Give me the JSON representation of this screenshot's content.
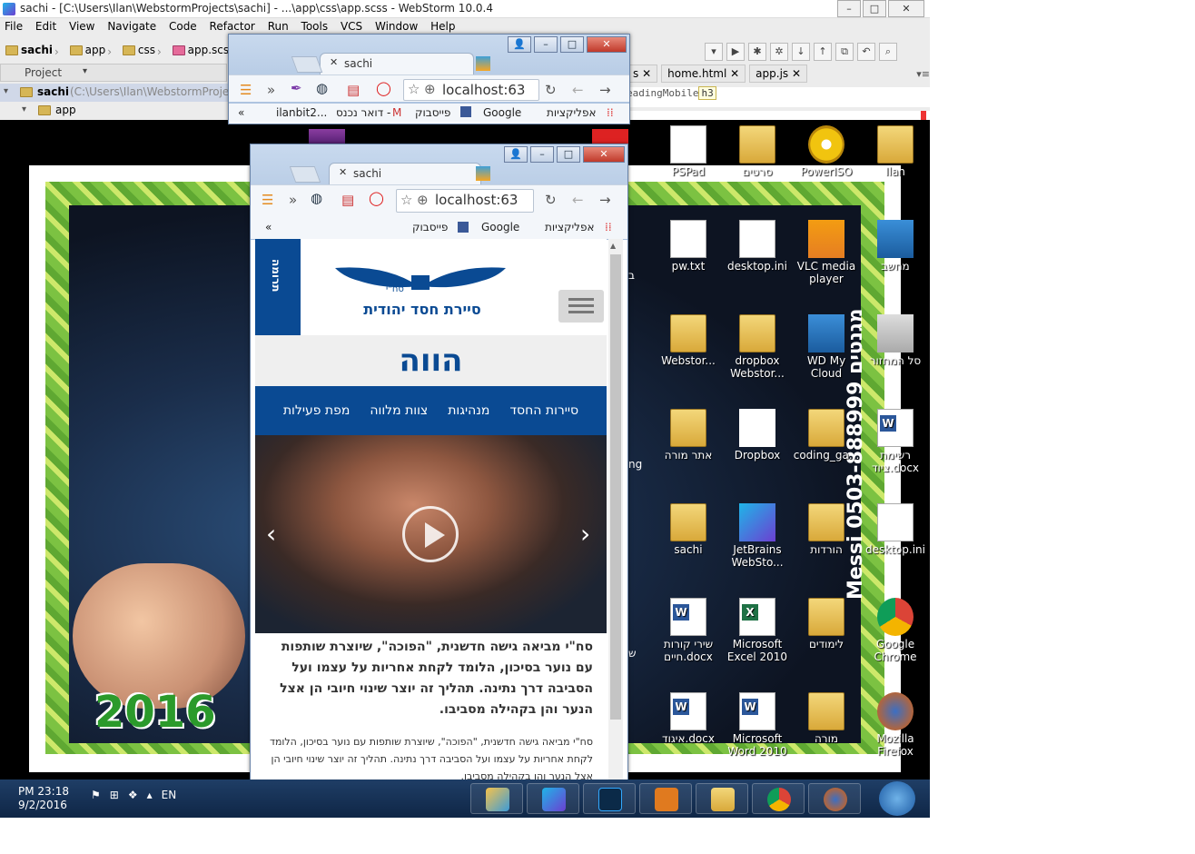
{
  "webstorm": {
    "title": "sachi - [C:\\Users\\Ilan\\WebstormProjects\\sachi] - ...\\app\\css\\app.scss - WebStorm 10.0.4",
    "menu": [
      "File",
      "Edit",
      "View",
      "Navigate",
      "Code",
      "Refactor",
      "Run",
      "Tools",
      "VCS",
      "Window",
      "Help"
    ],
    "breadcrumb": [
      "sachi",
      "app",
      "css",
      "app.scss"
    ],
    "project_label": "Project",
    "tree_root": "sachi",
    "tree_root_path": "(C:\\Users\\Ilan\\WebstormProject",
    "tree_child": "app",
    "tabs": [
      "home.html",
      "app.js"
    ],
    "editor_text": "eadingMobile",
    "editor_tag": "h3"
  },
  "desktop": {
    "photo_year": "2016",
    "vertical_text": "Messi מגנטים 0503-888999",
    "icons": [
      {
        "label": "PSPad",
        "kind": "doc"
      },
      {
        "label": "סרטים",
        "kind": "folder"
      },
      {
        "label": "PowerISO",
        "kind": "round"
      },
      {
        "label": "Ilan",
        "kind": "folder"
      },
      {
        "label": "pw.txt",
        "kind": "doc"
      },
      {
        "label": "desktop.ini",
        "kind": "doc"
      },
      {
        "label": "VLC media player",
        "kind": "vlc"
      },
      {
        "label": "מחשב",
        "kind": "pc"
      },
      {
        "label": "Webstor...",
        "kind": "folder"
      },
      {
        "label": "dropbox Webstor...",
        "kind": "folder"
      },
      {
        "label": "WD My Cloud",
        "kind": "cloud"
      },
      {
        "label": "סל המחזור",
        "kind": "bin"
      },
      {
        "label": "אתר מורה",
        "kind": "folder"
      },
      {
        "label": "Dropbox",
        "kind": "dropbox"
      },
      {
        "label": "coding_ga...",
        "kind": "folder"
      },
      {
        "label": "רשימת ציוד.docx",
        "kind": "word"
      },
      {
        "label": "sachi",
        "kind": "folder"
      },
      {
        "label": "JetBrains WebSto...",
        "kind": "ws"
      },
      {
        "label": "הורדות",
        "kind": "folder"
      },
      {
        "label": "desktop.ini",
        "kind": "doc"
      },
      {
        "label": "שירי קורות חיים.docx",
        "kind": "word"
      },
      {
        "label": "Microsoft Excel 2010",
        "kind": "excel"
      },
      {
        "label": "לימודים",
        "kind": "folder"
      },
      {
        "label": "Google Chrome",
        "kind": "chrome"
      },
      {
        "label": "איגוד.docx",
        "kind": "word"
      },
      {
        "label": "Microsoft Word 2010",
        "kind": "word"
      },
      {
        "label": "מורה",
        "kind": "folder"
      },
      {
        "label": "Mozilla Firefox",
        "kind": "firefox"
      }
    ],
    "partial_labels": [
      "ng",
      "ב",
      "ש"
    ]
  },
  "browser_back": {
    "tab_title": "sachi",
    "url": "localhost:63",
    "bookmarks": [
      "אפליקציות",
      "Google",
      "פייסבוק",
      "דואר נכנס -",
      "ilanbit2..."
    ]
  },
  "browser_front": {
    "tab_title": "sachi",
    "url": "localhost:63",
    "bookmarks": [
      "אפליקציות",
      "Google",
      "פייסבוק"
    ]
  },
  "site": {
    "side_label": "תרומה",
    "logo_text": "סיירת חסד יהודית",
    "logo_small": "סח\"י",
    "title": "הווה",
    "nav": [
      "סיירות החסד",
      "מנהיגות",
      "צוות מלווה",
      "מפת פעילות"
    ],
    "para1": "סח\"י מביאה גישה חדשנית, \"הפוכה\", שיוצרת שותפות עם נוער בסיכון, הלומד לקחת אחריות על עצמו ועל הסביבה דרך נתינה. תהליך זה יוצר שינוי חיובי הן אצל הנער והן בקהילה מסביבו.",
    "para2": "סח\"י מביאה גישה חדשנית, \"הפוכה\", שיוצרת שותפות עם נוער בסיכון, הלומד לקחת אחריות על עצמו ועל הסביבה דרך נתינה. תהליך זה יוצר שינוי חיובי הן אצל הנער והן בקהילה מסביבו."
  },
  "taskbar": {
    "time": "PM 23:18",
    "date": "9/2/2016",
    "lang": "EN"
  },
  "colors": {
    "site_blue": "#0a4a93",
    "taskbar": "#1f3e66",
    "grass": "#7cc242"
  }
}
